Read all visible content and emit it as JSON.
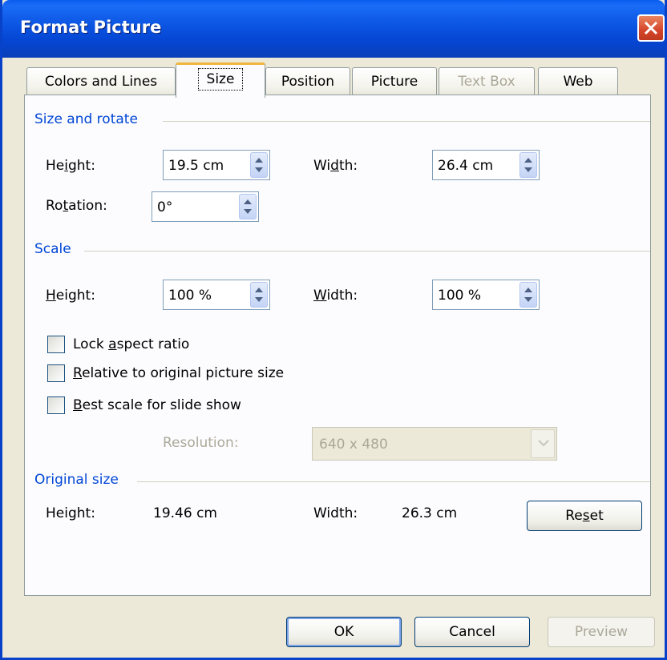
{
  "window": {
    "title": "Format Picture"
  },
  "tabs": [
    {
      "label": "Colors and Lines",
      "state": "normal"
    },
    {
      "label": "Size",
      "state": "active"
    },
    {
      "label": "Position",
      "state": "normal"
    },
    {
      "label": "Picture",
      "state": "normal"
    },
    {
      "label": "Text Box",
      "state": "disabled"
    },
    {
      "label": "Web",
      "state": "normal"
    }
  ],
  "size_rotate": {
    "heading": "Size and rotate",
    "height_label_pre": "He",
    "height_label_u": "i",
    "height_label_post": "ght:",
    "height_value": "19.5 cm",
    "width_label_pre": "Wi",
    "width_label_u": "d",
    "width_label_post": "th:",
    "width_value": "26.4 cm",
    "rotation_label_pre": "Ro",
    "rotation_label_u": "t",
    "rotation_label_post": "ation:",
    "rotation_value": "0°"
  },
  "scale": {
    "heading": "Scale",
    "height_label_u": "H",
    "height_label_post": "eight:",
    "height_value": "100 %",
    "width_label_u": "W",
    "width_label_post": "idth:",
    "width_value": "100 %",
    "lock_pre": "Lock ",
    "lock_u": "a",
    "lock_post": "spect ratio",
    "relative_u": "R",
    "relative_post": "elative to original picture size",
    "best_u": "B",
    "best_post": "est scale for slide show",
    "resolution_label": "Resolution:",
    "resolution_value": "640 x 480"
  },
  "original": {
    "heading": "Original size",
    "height_label": "Height:",
    "height_value": "19.46 cm",
    "width_label": "Width:",
    "width_value": "26.3 cm",
    "reset_pre": "Re",
    "reset_u": "s",
    "reset_post": "et"
  },
  "footer": {
    "ok": "OK",
    "cancel": "Cancel",
    "preview": "Preview"
  },
  "colors": {
    "title_bar": "#0b54e1",
    "section_heading": "#0046d5",
    "dialog_bg": "#ece9d8"
  }
}
